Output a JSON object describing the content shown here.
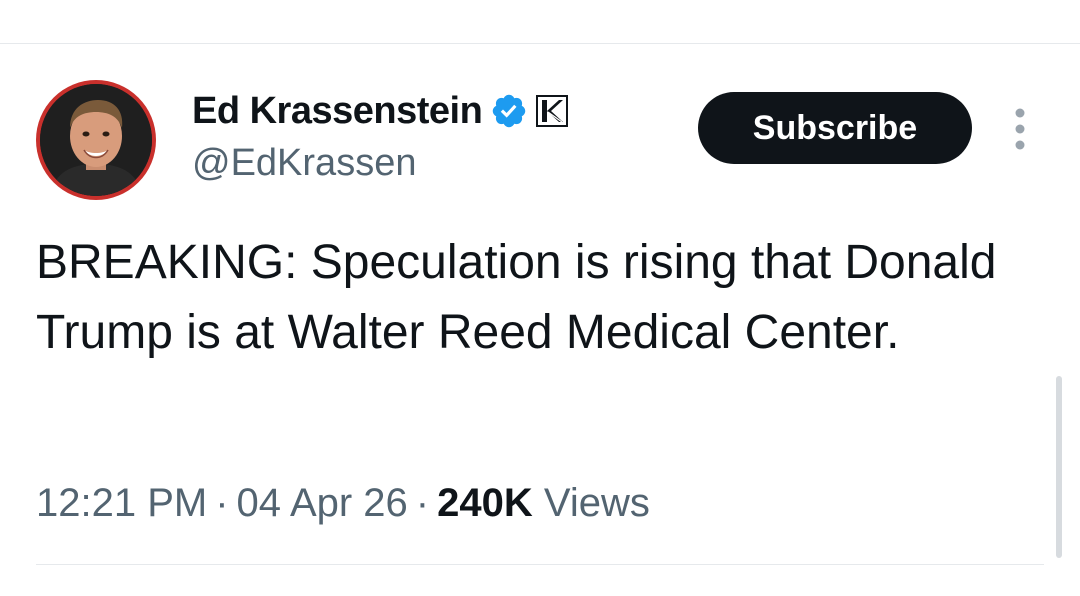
{
  "tweet": {
    "author": {
      "name": "Ed Krassenstein",
      "handle": "@EdKrassen",
      "verified_color": "#1d9bf0",
      "affiliate_badge_icon": "k-badge-icon"
    },
    "subscribe_label": "Subscribe",
    "text": "BREAKING: Speculation is rising that Donald Trump is at Walter Reed Medical Center.",
    "time": "12:21 PM",
    "date": "04 Apr 26",
    "separator": "·",
    "views_count": "240K",
    "views_label": "Views"
  },
  "colors": {
    "text_primary": "#0f1419",
    "text_secondary": "#536471",
    "button_bg": "#0f1419",
    "avatar_ring": "#c9302c"
  }
}
